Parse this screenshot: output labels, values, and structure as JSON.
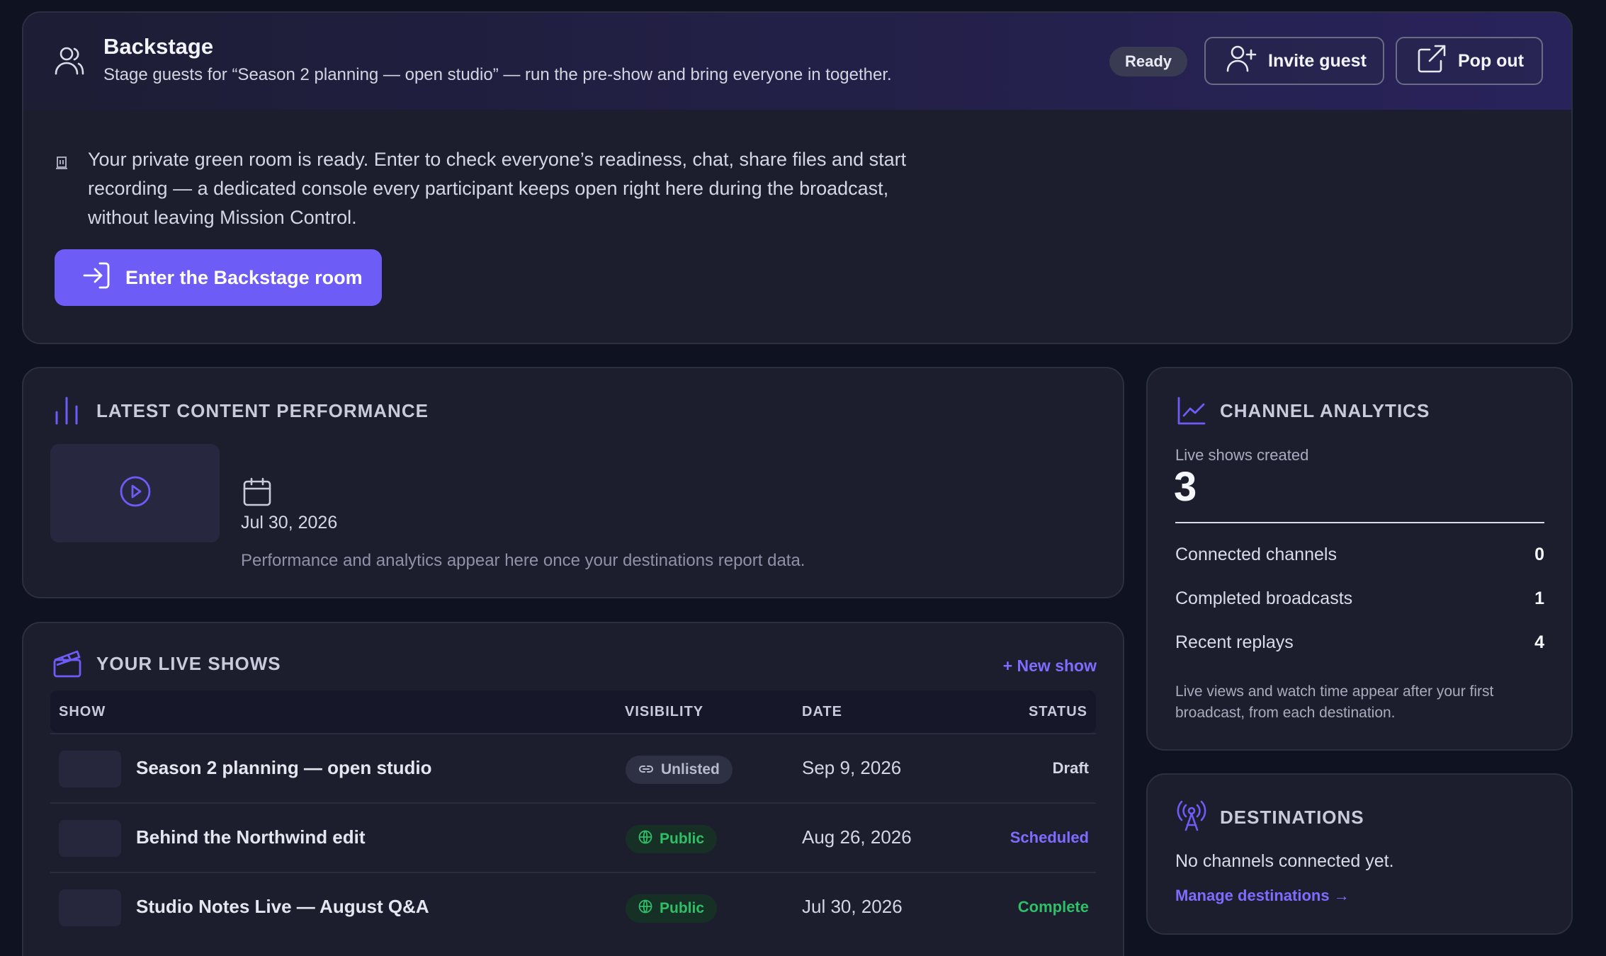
{
  "backstage": {
    "title": "Backstage",
    "subtitle": "Stage guests for “Season 2 planning — open studio” — run the pre-show and bring everyone in together.",
    "status_pill": "Ready",
    "invite_label": "Invite guest",
    "popout_label": "Pop out",
    "body_line1": "Your private green room is ready. Enter to check everyone’s readiness, chat, share files and start",
    "body_line2": "recording — a dedicated console every participant keeps open right here during the broadcast,",
    "body_line3": "without leaving Mission Control.",
    "enter_label": "Enter the Backstage room"
  },
  "latest": {
    "title": "LATEST CONTENT PERFORMANCE",
    "date": "Jul 30, 2026",
    "note": "Performance and analytics appear here once your destinations report data."
  },
  "analytics": {
    "title": "CHANNEL ANALYTICS",
    "created_label": "Live shows created",
    "created_value": "3",
    "stats": [
      {
        "label": "Connected channels",
        "value": "0"
      },
      {
        "label": "Completed broadcasts",
        "value": "1"
      },
      {
        "label": "Recent replays",
        "value": "4"
      }
    ],
    "note": "Live views and watch time appear after your first broadcast, from each destination."
  },
  "destinations": {
    "title": "DESTINATIONS",
    "text": "No channels connected yet.",
    "link": "Manage destinations →"
  },
  "shows": {
    "title": "YOUR LIVE SHOWS",
    "new_label": "+ New show",
    "columns": [
      "SHOW",
      "VISIBILITY",
      "DATE",
      "STATUS"
    ],
    "rows": [
      {
        "name": "Season 2 planning — open studio",
        "visibility": "Unlisted",
        "date": "Sep 9, 2026",
        "status": "Draft"
      },
      {
        "name": "Behind the Northwind edit",
        "visibility": "Public",
        "date": "Aug 26, 2026",
        "status": "Scheduled"
      },
      {
        "name": "Studio Notes Live — August Q&A",
        "visibility": "Public",
        "date": "Jul 30, 2026",
        "status": "Complete"
      }
    ]
  },
  "colors": {
    "accent": "#6e5cf6",
    "link": "#7f6cff",
    "public_green": "#2fbf67",
    "background": "#0f1220",
    "card": "#1c1e2d"
  }
}
